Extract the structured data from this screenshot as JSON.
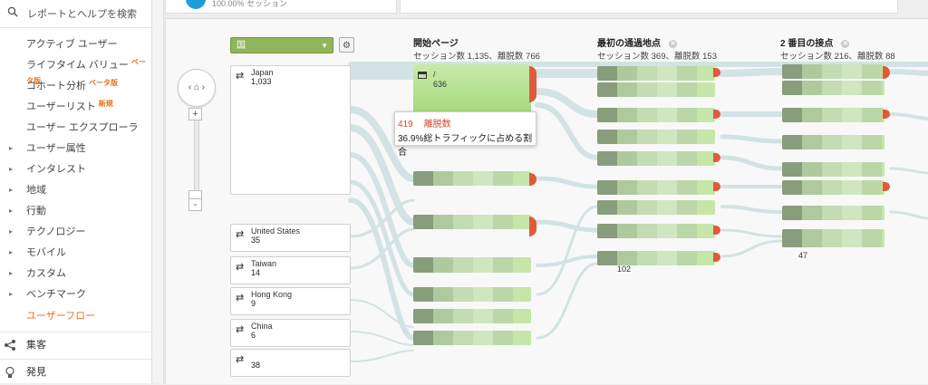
{
  "sidebar": {
    "search_label": "レポートとヘルプを検索",
    "items": [
      {
        "label": "アクティブ ユーザー",
        "arrow": "",
        "badge": ""
      },
      {
        "label": "ライフタイム バリュー",
        "arrow": "",
        "badge": "ベータ版"
      },
      {
        "label": "コホート分析",
        "arrow": "",
        "badge": "ベータ版"
      },
      {
        "label": "ユーザーリスト",
        "arrow": "",
        "badge": "新規"
      },
      {
        "label": "ユーザー エクスプローラ",
        "arrow": "",
        "badge": ""
      },
      {
        "label": "ユーザー属性",
        "arrow": "▸",
        "badge": ""
      },
      {
        "label": "インタレスト",
        "arrow": "▸",
        "badge": ""
      },
      {
        "label": "地域",
        "arrow": "▸",
        "badge": ""
      },
      {
        "label": "行動",
        "arrow": "▸",
        "badge": ""
      },
      {
        "label": "テクノロジー",
        "arrow": "▸",
        "badge": ""
      },
      {
        "label": "モバイル",
        "arrow": "▸",
        "badge": ""
      },
      {
        "label": "カスタム",
        "arrow": "▸",
        "badge": ""
      },
      {
        "label": "ベンチマーク",
        "arrow": "▸",
        "badge": ""
      },
      {
        "label": "ユーザーフロー",
        "arrow": "",
        "badge": ""
      }
    ],
    "sections": [
      {
        "label": "集客",
        "icon": "acquisition-icon"
      },
      {
        "label": "発見",
        "icon": "lightbulb-icon"
      }
    ]
  },
  "top_card": {
    "text": "100.00% セッション"
  },
  "controls": {
    "dimension_select": "国",
    "settings_icon": "gear-icon",
    "home_icon": "home-icon",
    "zoom_in": "+",
    "zoom_out": "-"
  },
  "columns": [
    {
      "title": "開始ページ",
      "subtitle": "セッション数 1,135、離脱数 766"
    },
    {
      "title": "最初の通過地点",
      "subtitle": "セッション数 369、離脱数 153"
    },
    {
      "title": "2 番目の接点",
      "subtitle": "セッション数 216、離脱数 88"
    }
  ],
  "countries": [
    {
      "name": "Japan",
      "sessions": "1,033"
    },
    {
      "name": "United States",
      "sessions": "35"
    },
    {
      "name": "Taiwan",
      "sessions": "14"
    },
    {
      "name": "Hong Kong",
      "sessions": "9"
    },
    {
      "name": "China",
      "sessions": "6"
    },
    {
      "name": "",
      "sessions": "38"
    }
  ],
  "top_node": {
    "name": "/",
    "sessions": "636"
  },
  "tooltip": {
    "dropoffs": "419",
    "dropoff_label": "離脱数",
    "share": "36.9%総トラフィックに占める割合"
  },
  "visible_counts": {
    "col2_bottom": "102",
    "col3_bottom": "47"
  },
  "colors": {
    "node_green": "#c5e6a8",
    "node_green_dark": "#8fc25f",
    "dropoff_red": "#e05a3a",
    "flow_gray": "#d5e3e5",
    "accent_orange": "#e8711c"
  }
}
